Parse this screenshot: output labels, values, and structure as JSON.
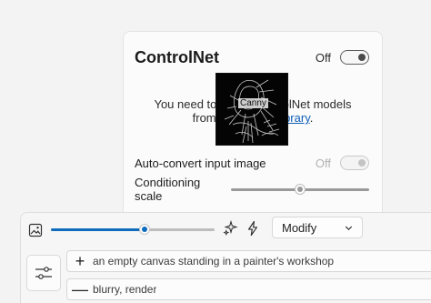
{
  "controlnet": {
    "title": "ControlNet",
    "enabled_label": "Off",
    "message_line1": "You need to install ControlNet models",
    "message_line2_prefix": "from the ",
    "message_link": "Model Library",
    "message_line2_suffix": ".",
    "preview_label": "Canny",
    "auto_convert_label": "Auto-convert input image",
    "auto_convert_state": "Off",
    "conditioning_scale_label": "Conditioning scale",
    "conditioning_scale_value": 0.5
  },
  "toolbar": {
    "strength_value": 0.57,
    "mode_label": "Modify"
  },
  "prompts": {
    "positive": "an empty canvas standing in a painter's workshop",
    "negative": "blurry, render"
  },
  "colors": {
    "accent": "#0f6cbd",
    "link": "#0f5fb8"
  },
  "icons": {
    "image": "image-icon",
    "sparkle": "sparkle-icon",
    "bolt": "bolt-icon",
    "chevron": "chevron-down-icon",
    "settings": "sliders-icon"
  }
}
